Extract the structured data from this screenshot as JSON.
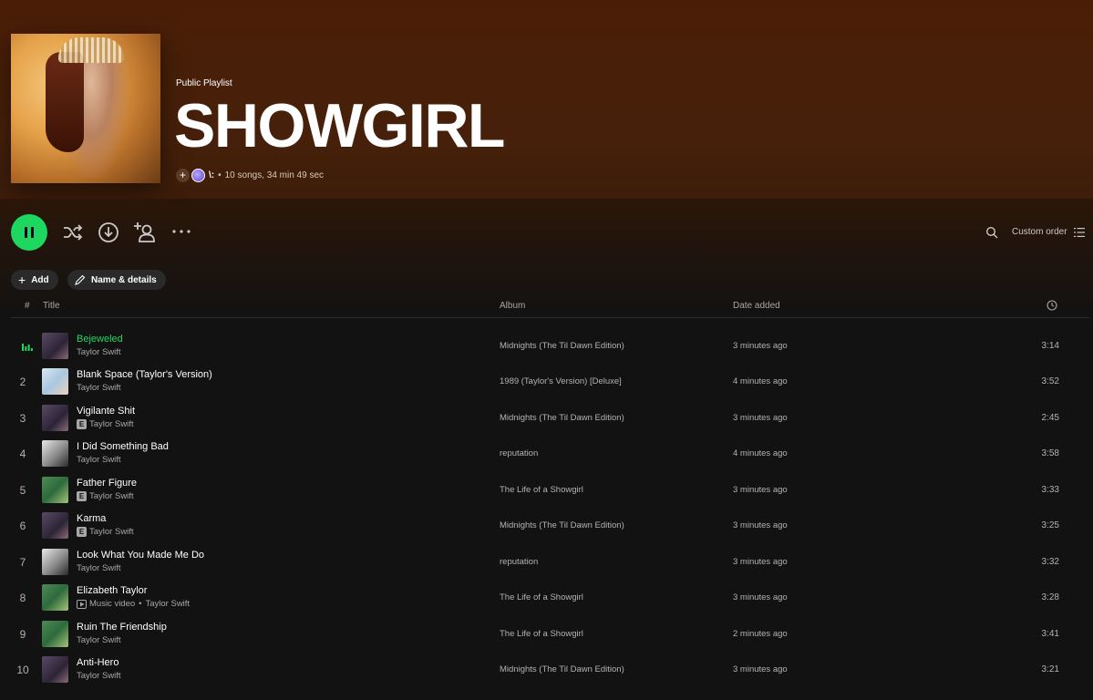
{
  "playlist": {
    "type_label": "Public Playlist",
    "title": "SHOWGIRL",
    "owner": "\\:",
    "separator": "•",
    "summary": "10 songs, 34 min 49 sec"
  },
  "controls": {
    "sort_label": "Custom order",
    "add_label": "Add",
    "details_label": "Name & details"
  },
  "columns": {
    "number": "#",
    "title": "Title",
    "album": "Album",
    "date_added": "Date added"
  },
  "colors": {
    "accent": "#1ed760",
    "header": "#4a1e06",
    "background": "#121212"
  },
  "icons": {
    "play_pause": "pause-icon",
    "shuffle": "shuffle-icon",
    "download": "download-icon",
    "invite": "add-user-icon",
    "more": "more-icon",
    "search": "search-icon",
    "sort": "list-icon",
    "clock": "clock-icon"
  },
  "tracks": [
    {
      "num": "1",
      "title": "Bejeweled",
      "artist": "Taylor Swift",
      "explicit": false,
      "video": false,
      "album": "Midnights (The Til Dawn Edition)",
      "date": "3 minutes ago",
      "duration": "3:14",
      "playing": true
    },
    {
      "num": "2",
      "title": "Blank Space (Taylor's Version)",
      "artist": "Taylor Swift",
      "explicit": false,
      "video": false,
      "album": "1989 (Taylor's Version) [Deluxe]",
      "date": "4 minutes ago",
      "duration": "3:52",
      "playing": false
    },
    {
      "num": "3",
      "title": "Vigilante Shit",
      "artist": "Taylor Swift",
      "explicit": true,
      "video": false,
      "album": "Midnights (The Til Dawn Edition)",
      "date": "3 minutes ago",
      "duration": "2:45",
      "playing": false
    },
    {
      "num": "4",
      "title": "I Did Something Bad",
      "artist": "Taylor Swift",
      "explicit": false,
      "video": false,
      "album": "reputation",
      "date": "4 minutes ago",
      "duration": "3:58",
      "playing": false
    },
    {
      "num": "5",
      "title": "Father Figure",
      "artist": "Taylor Swift",
      "explicit": true,
      "video": false,
      "album": "The Life of a Showgirl",
      "date": "3 minutes ago",
      "duration": "3:33",
      "playing": false
    },
    {
      "num": "6",
      "title": "Karma",
      "artist": "Taylor Swift",
      "explicit": true,
      "video": false,
      "album": "Midnights (The Til Dawn Edition)",
      "date": "3 minutes ago",
      "duration": "3:25",
      "playing": false
    },
    {
      "num": "7",
      "title": "Look What You Made Me Do",
      "artist": "Taylor Swift",
      "explicit": false,
      "video": false,
      "album": "reputation",
      "date": "3 minutes ago",
      "duration": "3:32",
      "playing": false
    },
    {
      "num": "8",
      "title": "Elizabeth Taylor",
      "artist": "Taylor Swift",
      "explicit": false,
      "video": true,
      "video_label": "Music video",
      "album": "The Life of a Showgirl",
      "date": "3 minutes ago",
      "duration": "3:28",
      "playing": false
    },
    {
      "num": "9",
      "title": "Ruin The Friendship",
      "artist": "Taylor Swift",
      "explicit": false,
      "video": false,
      "album": "The Life of a Showgirl",
      "date": "2 minutes ago",
      "duration": "3:41",
      "playing": false
    },
    {
      "num": "10",
      "title": "Anti-Hero",
      "artist": "Taylor Swift",
      "explicit": false,
      "video": false,
      "album": "Midnights (The Til Dawn Edition)",
      "date": "3 minutes ago",
      "duration": "3:21",
      "playing": false
    }
  ]
}
